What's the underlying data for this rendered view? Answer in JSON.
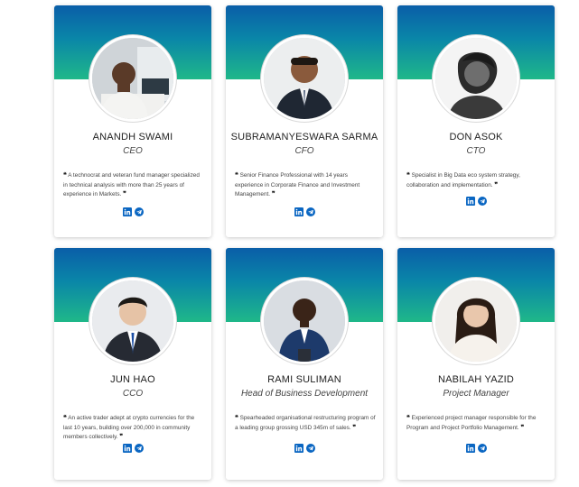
{
  "team": [
    {
      "name": "ANANDH SWAMI",
      "role": "CEO",
      "bio": "A technocrat and veteran fund manager specialized in technical analysis with more than 25 years of experience in Markets.",
      "avatar": "avatar-photo",
      "links": [
        "linkedin-icon",
        "telegram-icon"
      ]
    },
    {
      "name": "SUBRAMANYESWARA SARMA",
      "role": "CFO",
      "bio": "Senior Finance Professional with 14 years experience in Corporate Finance and Investment Management.",
      "avatar": "avatar-photo",
      "links": [
        "linkedin-icon",
        "telegram-icon"
      ]
    },
    {
      "name": "DON ASOK",
      "role": "CTO",
      "bio": "Specialist in Big Data eco system strategy, collaboration and implementation.",
      "avatar": "avatar-photo",
      "links": [
        "linkedin-icon",
        "telegram-icon"
      ]
    },
    {
      "name": "JUN HAO",
      "role": "CCO",
      "bio": "An active trader adept at crypto currencies for the last 10 years, building over 200,000 in community members collectively.",
      "avatar": "avatar-photo",
      "links": [
        "linkedin-icon",
        "telegram-icon"
      ]
    },
    {
      "name": "RAMI SULIMAN",
      "role": "Head of Business Development",
      "bio": "Spearheaded organisational restructuring program of a leading group grossing USD 345m of sales.",
      "avatar": "avatar-photo",
      "links": [
        "linkedin-icon",
        "telegram-icon"
      ]
    },
    {
      "name": "NABILAH YAZID",
      "role": "Project Manager",
      "bio": "Experienced project manager responsible for the Program and Project Portfolio Management.",
      "avatar": "avatar-photo",
      "links": [
        "linkedin-icon",
        "telegram-icon"
      ]
    }
  ],
  "quote_open": "❝",
  "quote_close": "❞",
  "colors": {
    "header_top": "#0a5ea8",
    "header_bottom": "#1fb889",
    "icon": "#0a66c2"
  }
}
